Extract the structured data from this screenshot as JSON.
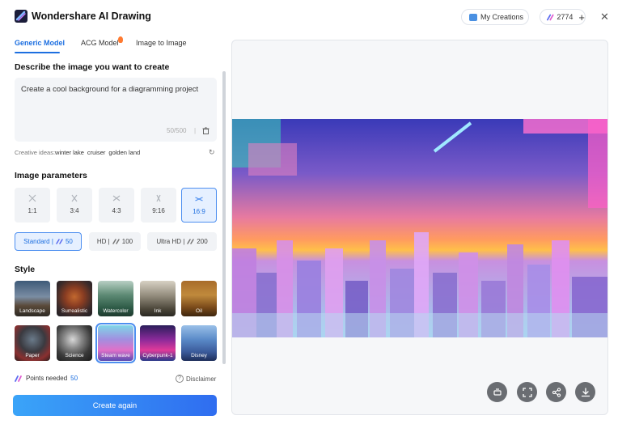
{
  "header": {
    "title": "Wondershare AI Drawing",
    "my_creations": "My Creations",
    "points": "2774",
    "plus": "+",
    "close": "✕"
  },
  "tabs": [
    "Generic Model",
    "ACG Model",
    "Image to Image"
  ],
  "prompt": {
    "heading": "Describe the image you want to create",
    "text": "Create a cool background for a diagramming project",
    "count": "50/500",
    "separator": "|"
  },
  "ideas": {
    "label": "Creative ideas:",
    "items": [
      "winter lake",
      "cruiser",
      "golden land"
    ]
  },
  "params": {
    "heading": "Image parameters",
    "ratios": [
      "1:1",
      "3:4",
      "4:3",
      "9:16",
      "16:9"
    ],
    "selected_ratio": "16:9",
    "qualities": [
      {
        "label": "Standard |",
        "points": "50"
      },
      {
        "label": "HD |",
        "points": "100"
      },
      {
        "label": "Ultra HD |",
        "points": "200"
      }
    ]
  },
  "style": {
    "heading": "Style",
    "items": [
      "Landscape",
      "Surrealistic",
      "Watercolor",
      "Ink",
      "Oil",
      "Paper",
      "Science",
      "Steam wave",
      "Cyberpunk-1",
      "Disney"
    ],
    "selected": "Steam wave"
  },
  "footer": {
    "points_needed_label": "Points needed",
    "points_needed": "50",
    "disclaimer": "Disclaimer",
    "create_button": "Create again"
  },
  "colors": {
    "accent": "#1d6fe0",
    "button_start": "#3aa4f8",
    "button_end": "#2f6df0"
  },
  "actions": [
    "crop-icon",
    "fullscreen-icon",
    "share-icon",
    "download-icon"
  ]
}
